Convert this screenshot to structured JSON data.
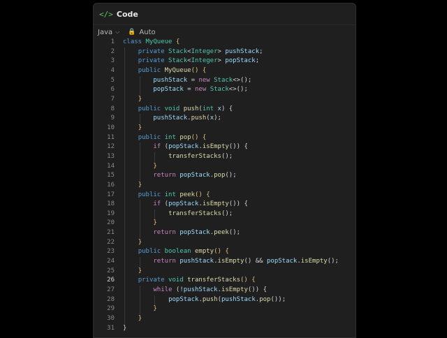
{
  "header": {
    "title": "Code",
    "icon": "code-icon"
  },
  "toolbar": {
    "language": "Java",
    "mode": "Auto"
  },
  "current_line": 26,
  "colors": {
    "keyword": "#569cd6",
    "type": "#4ec9b0",
    "function": "#dcdcaa",
    "variable": "#9cdcfe",
    "control": "#c586c0"
  },
  "lines": [
    {
      "i": 0,
      "t": [
        [
          "class ",
          "k"
        ],
        [
          "MyQueue ",
          "t"
        ],
        [
          "{",
          "b"
        ]
      ]
    },
    {
      "i": 1,
      "t": [
        [
          "private ",
          "k"
        ],
        [
          "Stack",
          "t"
        ],
        [
          "<",
          "p"
        ],
        [
          "Integer",
          "t"
        ],
        [
          "> ",
          "p"
        ],
        [
          "pushStack",
          "v"
        ],
        [
          ";",
          "p"
        ]
      ]
    },
    {
      "i": 1,
      "t": [
        [
          "private ",
          "k"
        ],
        [
          "Stack",
          "t"
        ],
        [
          "<",
          "p"
        ],
        [
          "Integer",
          "t"
        ],
        [
          "> ",
          "p"
        ],
        [
          "popStack",
          "v"
        ],
        [
          ";",
          "p"
        ]
      ]
    },
    {
      "i": 1,
      "t": [
        [
          "public ",
          "k"
        ],
        [
          "MyQueue",
          "f"
        ],
        [
          "() {",
          "b"
        ]
      ]
    },
    {
      "i": 2,
      "t": [
        [
          "pushStack",
          "v"
        ],
        [
          " = ",
          "p"
        ],
        [
          "new ",
          "c"
        ],
        [
          "Stack",
          "t"
        ],
        [
          "<>();",
          "p"
        ]
      ]
    },
    {
      "i": 2,
      "t": [
        [
          "popStack",
          "v"
        ],
        [
          " = ",
          "p"
        ],
        [
          "new ",
          "c"
        ],
        [
          "Stack",
          "t"
        ],
        [
          "<>();",
          "p"
        ]
      ]
    },
    {
      "i": 1,
      "t": [
        [
          "}",
          "b"
        ]
      ]
    },
    {
      "i": 1,
      "t": [
        [
          "public ",
          "k"
        ],
        [
          "void ",
          "t"
        ],
        [
          "push",
          "f"
        ],
        [
          "(",
          "p"
        ],
        [
          "int ",
          "t"
        ],
        [
          "x",
          "v"
        ],
        [
          ") {",
          "p"
        ]
      ]
    },
    {
      "i": 2,
      "t": [
        [
          "pushStack",
          "v"
        ],
        [
          ".",
          "p"
        ],
        [
          "push",
          "f"
        ],
        [
          "(",
          "p"
        ],
        [
          "x",
          "v"
        ],
        [
          ");",
          "p"
        ]
      ]
    },
    {
      "i": 1,
      "t": [
        [
          "}",
          "b"
        ]
      ]
    },
    {
      "i": 1,
      "t": [
        [
          "public ",
          "k"
        ],
        [
          "int ",
          "t"
        ],
        [
          "pop",
          "f"
        ],
        [
          "() {",
          "b"
        ]
      ]
    },
    {
      "i": 2,
      "t": [
        [
          "if ",
          "c"
        ],
        [
          "(",
          "p"
        ],
        [
          "popStack",
          "v"
        ],
        [
          ".",
          "p"
        ],
        [
          "isEmpty",
          "f"
        ],
        [
          "()) {",
          "p"
        ]
      ]
    },
    {
      "i": 3,
      "t": [
        [
          "transferStacks",
          "f"
        ],
        [
          "();",
          "p"
        ]
      ]
    },
    {
      "i": 2,
      "t": [
        [
          "}",
          "b"
        ]
      ]
    },
    {
      "i": 2,
      "t": [
        [
          "return ",
          "c"
        ],
        [
          "popStack",
          "v"
        ],
        [
          ".",
          "p"
        ],
        [
          "pop",
          "f"
        ],
        [
          "();",
          "p"
        ]
      ]
    },
    {
      "i": 1,
      "t": [
        [
          "}",
          "b"
        ]
      ]
    },
    {
      "i": 1,
      "t": [
        [
          "public ",
          "k"
        ],
        [
          "int ",
          "t"
        ],
        [
          "peek",
          "f"
        ],
        [
          "() {",
          "b"
        ]
      ]
    },
    {
      "i": 2,
      "t": [
        [
          "if ",
          "c"
        ],
        [
          "(",
          "p"
        ],
        [
          "popStack",
          "v"
        ],
        [
          ".",
          "p"
        ],
        [
          "isEmpty",
          "f"
        ],
        [
          "()) {",
          "p"
        ]
      ]
    },
    {
      "i": 3,
      "t": [
        [
          "transferStacks",
          "f"
        ],
        [
          "();",
          "p"
        ]
      ]
    },
    {
      "i": 2,
      "t": [
        [
          "}",
          "b"
        ]
      ]
    },
    {
      "i": 2,
      "t": [
        [
          "return ",
          "c"
        ],
        [
          "popStack",
          "v"
        ],
        [
          ".",
          "p"
        ],
        [
          "peek",
          "f"
        ],
        [
          "();",
          "p"
        ]
      ]
    },
    {
      "i": 1,
      "t": [
        [
          "}",
          "b"
        ]
      ]
    },
    {
      "i": 1,
      "t": [
        [
          "public ",
          "k"
        ],
        [
          "boolean ",
          "t"
        ],
        [
          "empty",
          "f"
        ],
        [
          "() {",
          "b"
        ]
      ]
    },
    {
      "i": 2,
      "t": [
        [
          "return ",
          "c"
        ],
        [
          "pushStack",
          "v"
        ],
        [
          ".",
          "p"
        ],
        [
          "isEmpty",
          "f"
        ],
        [
          "() && ",
          "p"
        ],
        [
          "popStack",
          "v"
        ],
        [
          ".",
          "p"
        ],
        [
          "isEmpty",
          "f"
        ],
        [
          "();",
          "p"
        ]
      ]
    },
    {
      "i": 1,
      "t": [
        [
          "}",
          "b"
        ]
      ]
    },
    {
      "i": 1,
      "t": [
        [
          "private ",
          "k"
        ],
        [
          "void ",
          "t"
        ],
        [
          "transferStacks",
          "f"
        ],
        [
          "() {",
          "b"
        ]
      ]
    },
    {
      "i": 2,
      "t": [
        [
          "while ",
          "c"
        ],
        [
          "(!",
          "p"
        ],
        [
          "pushStack",
          "v"
        ],
        [
          ".",
          "p"
        ],
        [
          "isEmpty",
          "f"
        ],
        [
          "()) {",
          "p"
        ]
      ]
    },
    {
      "i": 3,
      "t": [
        [
          "popStack",
          "v"
        ],
        [
          ".",
          "p"
        ],
        [
          "push",
          "f"
        ],
        [
          "(",
          "p"
        ],
        [
          "pushStack",
          "v"
        ],
        [
          ".",
          "p"
        ],
        [
          "pop",
          "f"
        ],
        [
          "());",
          "p"
        ]
      ]
    },
    {
      "i": 2,
      "t": [
        [
          "}",
          "b"
        ]
      ]
    },
    {
      "i": 1,
      "t": [
        [
          "}",
          "b"
        ]
      ]
    },
    {
      "i": 0,
      "t": [
        [
          "}",
          "p"
        ]
      ]
    }
  ]
}
